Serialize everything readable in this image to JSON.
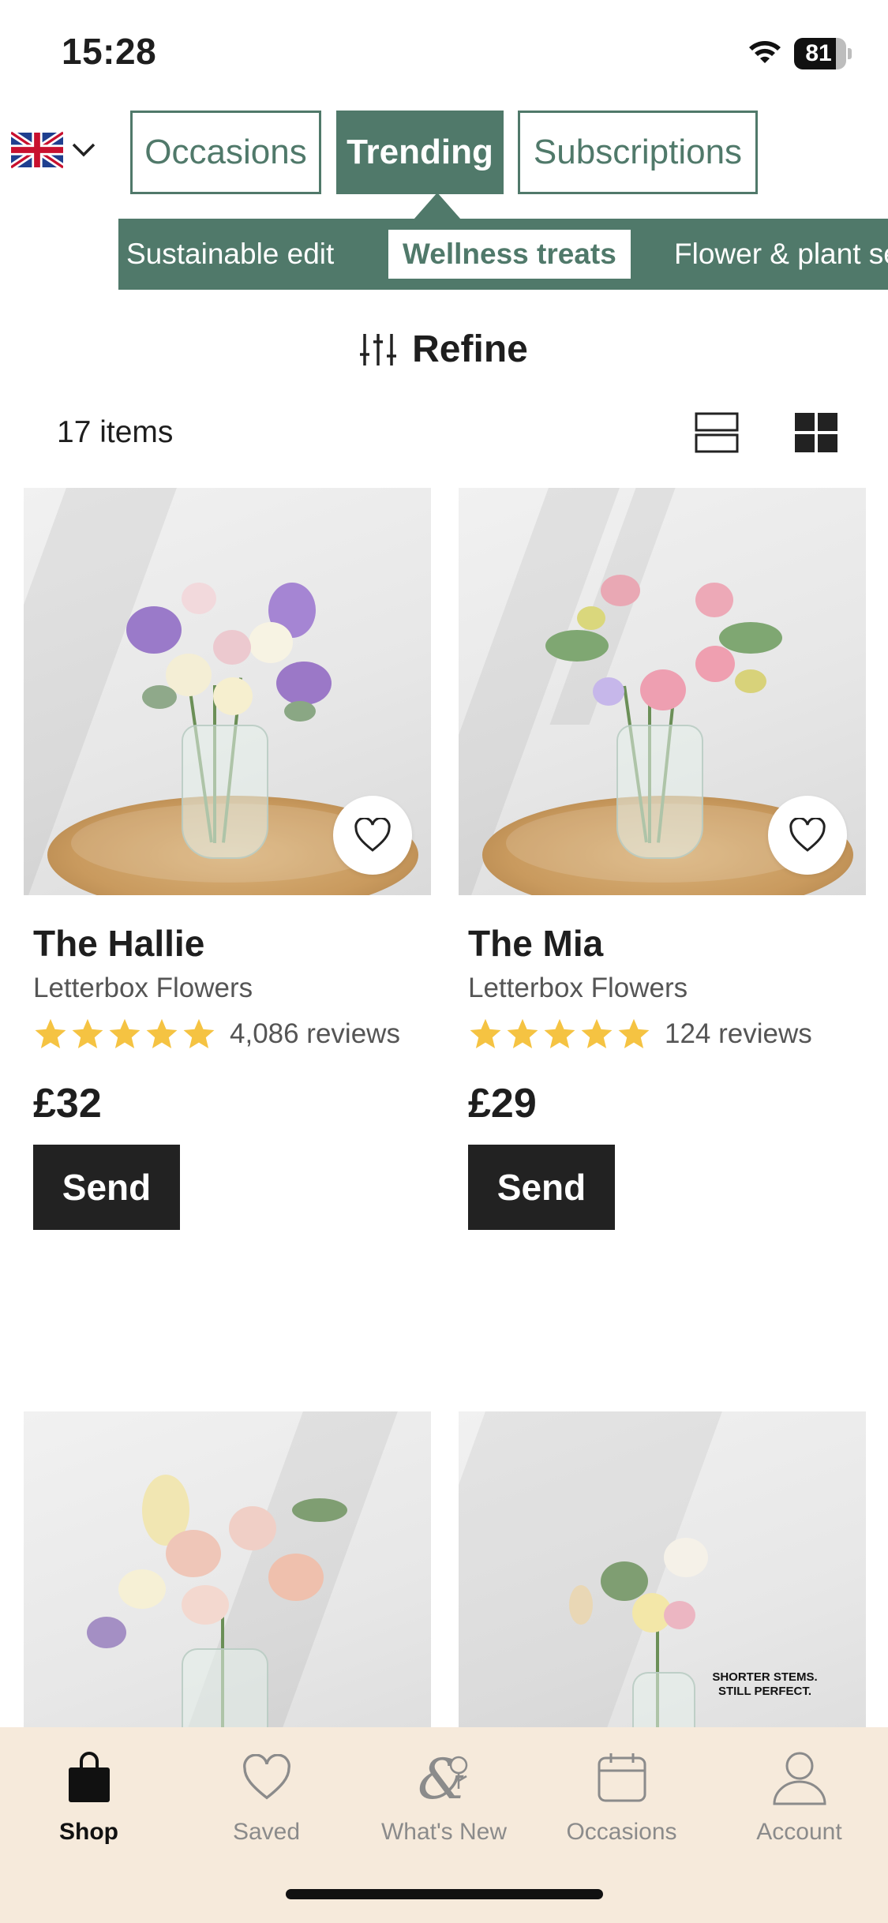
{
  "status_bar": {
    "time": "15:28",
    "battery_percent": "81",
    "battery_level": 0.81
  },
  "country": {
    "flag": "uk-flag-icon",
    "chevron": "chevron-down-icon"
  },
  "tabs": [
    {
      "label": "Occasions",
      "active": false
    },
    {
      "label": "Trending",
      "active": true
    },
    {
      "label": "Subscriptions",
      "active": false
    }
  ],
  "subnav": [
    {
      "label": "Sustainable edit",
      "active": false
    },
    {
      "label": "Wellness treats",
      "active": true
    },
    {
      "label": "Flower & plant se",
      "active": false
    }
  ],
  "refine": {
    "label": "Refine",
    "icon": "sliders-icon"
  },
  "listing": {
    "count_label": "17 items"
  },
  "products": [
    {
      "title": "The Hallie",
      "brand": "Letterbox Flowers",
      "rating": 5,
      "reviews": "4,086 reviews",
      "price": "£32",
      "cta": "Send"
    },
    {
      "title": "The Mia",
      "brand": "Letterbox Flowers",
      "rating": 5,
      "reviews": "124 reviews",
      "price": "£29",
      "cta": "Send"
    },
    {
      "image_text_line1": "SHORTER STEMS.",
      "image_text_line2": "STILL PERFECT."
    }
  ],
  "tabbar": [
    {
      "label": "Shop",
      "icon": "bag-icon",
      "active": true
    },
    {
      "label": "Saved",
      "icon": "heart-icon",
      "active": false
    },
    {
      "label": "What's New",
      "icon": "ampersand-flower-icon",
      "active": false
    },
    {
      "label": "Occasions",
      "icon": "calendar-icon",
      "active": false
    },
    {
      "label": "Account",
      "icon": "person-icon",
      "active": false
    }
  ],
  "colors": {
    "brand_green": "#50796a",
    "star_yellow": "#f5c342",
    "tabbar_bg": "#f6eadb",
    "button_dark": "#222222"
  }
}
